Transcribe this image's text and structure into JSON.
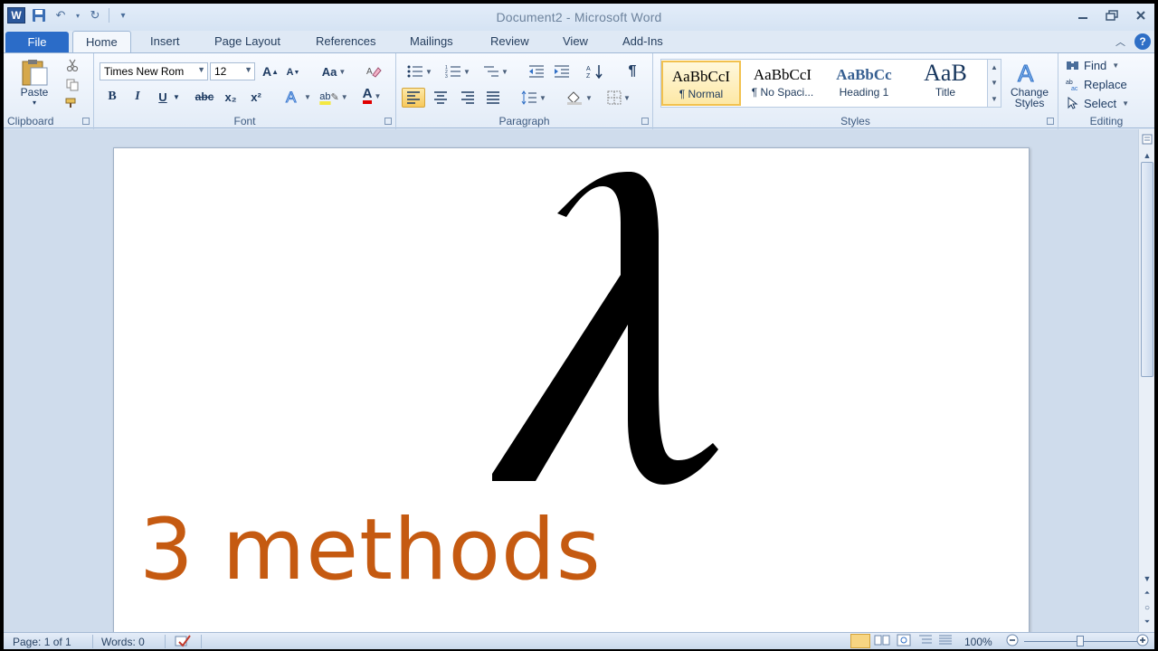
{
  "window": {
    "title": "Document2  -  Microsoft Word",
    "app_icon": "W"
  },
  "tabs": {
    "file": "File",
    "items": [
      "Home",
      "Insert",
      "Page Layout",
      "References",
      "Mailings",
      "Review",
      "View",
      "Add-Ins"
    ],
    "active": "Home"
  },
  "ribbon": {
    "clipboard": {
      "label": "Clipboard",
      "paste": "Paste"
    },
    "font": {
      "label": "Font",
      "font_name": "Times New Rom",
      "font_size": "12",
      "grow": "A",
      "shrink": "A",
      "change_case": "Aa",
      "bold": "B",
      "italic": "I",
      "underline": "U",
      "strikethrough": "abc",
      "subscript": "x₂",
      "superscript": "x²",
      "font_color_letter": "A",
      "highlight_letters": "ab"
    },
    "paragraph": {
      "label": "Paragraph",
      "pilcrow": "¶"
    },
    "styles": {
      "label": "Styles",
      "items": [
        {
          "sample": "AaBbCcI",
          "name": "¶ Normal"
        },
        {
          "sample": "AaBbCcI",
          "name": "¶ No Spaci..."
        },
        {
          "sample": "AaBbCc",
          "name": "Heading 1"
        },
        {
          "sample": "AaB",
          "name": "Title"
        }
      ],
      "change_styles": "Change\nStyles"
    },
    "editing": {
      "label": "Editing",
      "find": "Find",
      "replace": "Replace",
      "select": "Select"
    }
  },
  "document": {
    "symbol": "λ",
    "text": "3 methods",
    "text_color": "#c55a11"
  },
  "status": {
    "page": "Page: 1 of 1",
    "words": "Words: 0",
    "zoom": "100%",
    "zoom_fraction": 0.5
  },
  "colors": {
    "file_tab": "#2b6cc8",
    "accent": "#c55a11"
  }
}
